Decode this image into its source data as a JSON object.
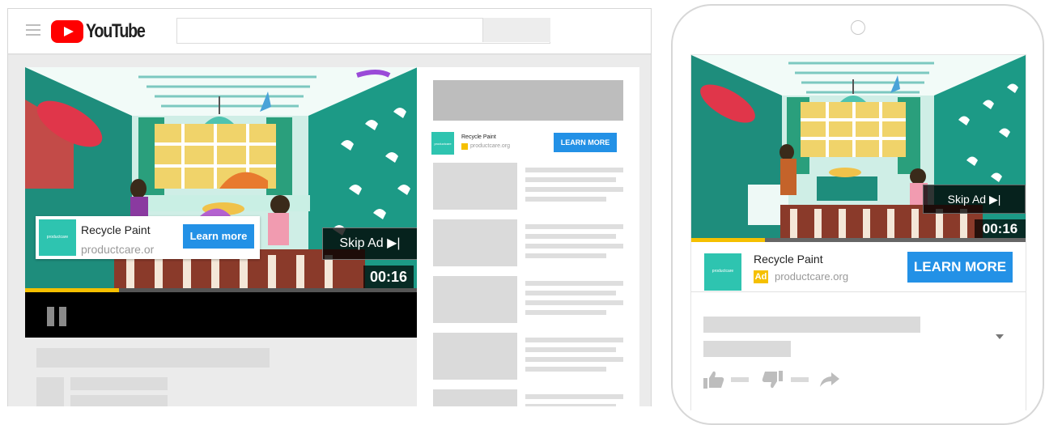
{
  "desktop": {
    "brand": {
      "name": "YouTube",
      "logo_icon": "youtube-play-icon",
      "logo_color": "#ff0000"
    },
    "search": {
      "value": "",
      "placeholder": ""
    },
    "player": {
      "progress": 0.24,
      "ad_card": {
        "title": "Recycle Paint",
        "url": "productcare.or",
        "cta": "Learn more"
      },
      "skip_label": "Skip Ad ▶|",
      "timer": "00:16"
    },
    "sidebar_ad": {
      "title": "Recycle Paint",
      "url": "productcare.org",
      "cta": "LEARN MORE"
    }
  },
  "mobile": {
    "player": {
      "progress": 0.22,
      "skip_label": "Skip Ad ▶|",
      "timer": "00:16"
    },
    "ad_row": {
      "title": "Recycle Paint",
      "badge": "Ad",
      "url": "productcare.org",
      "cta": "LEARN MORE"
    },
    "icons": [
      "thumbs-up-icon",
      "thumbs-down-icon",
      "share-icon",
      "chevron-down-icon"
    ]
  },
  "colors": {
    "accent_blue": "#2391e6",
    "progress_yellow": "#f5c000",
    "brand_teal": "#2ec4b0"
  }
}
